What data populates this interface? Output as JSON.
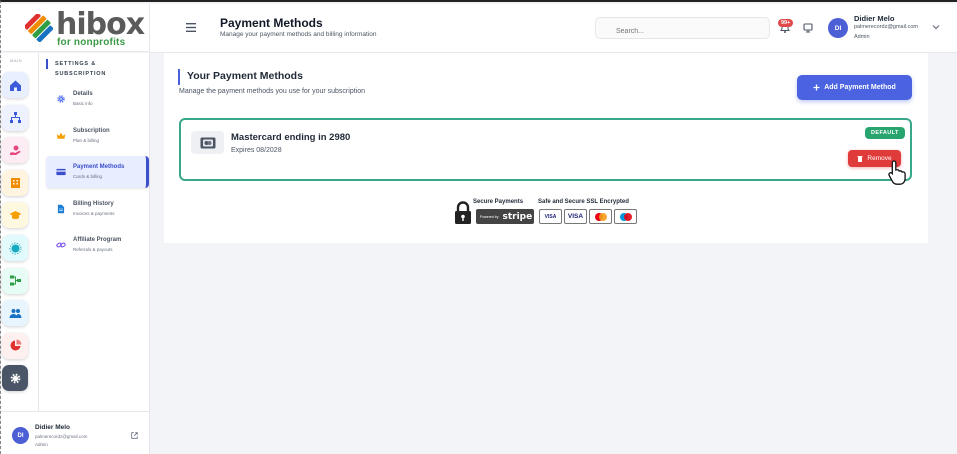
{
  "brand": {
    "name": "hibox",
    "subtitle": "for nonprofits"
  },
  "rail": {
    "label": "MAIN",
    "items": [
      {
        "name": "home",
        "icon": "home-icon",
        "color": "#3b5bdb",
        "bg": "#e8f0ff"
      },
      {
        "name": "org",
        "icon": "sitemap-icon",
        "color": "#3b5bdb",
        "bg": "#eef2ff"
      },
      {
        "name": "donations",
        "icon": "hand-holding-icon",
        "color": "#e64980",
        "bg": "#fdecf3"
      },
      {
        "name": "library",
        "icon": "building-icon",
        "color": "#f08c00",
        "bg": "#fff4e0"
      },
      {
        "name": "education",
        "icon": "graduation-cap-icon",
        "color": "#f59f00",
        "bg": "#fff8e1"
      },
      {
        "name": "bubbles",
        "icon": "bubble-icon",
        "color": "#15aabf",
        "bg": "#e3fafc"
      },
      {
        "name": "flows",
        "icon": "flow-icon",
        "color": "#2f9e44",
        "bg": "#e6fcf5"
      },
      {
        "name": "people",
        "icon": "users-icon",
        "color": "#1971c2",
        "bg": "#e7f5ff"
      },
      {
        "name": "reports",
        "icon": "pie-chart-icon",
        "color": "#e03131",
        "bg": "#fff0f0"
      },
      {
        "name": "settings",
        "icon": "gear-icon",
        "color": "#ffffff",
        "bg": "#4a5568"
      }
    ]
  },
  "settings_panel": {
    "title": "SETTINGS & SUBSCRIPTION",
    "items": [
      {
        "title": "Details",
        "sub": "Basic info",
        "icon": "gear-icon",
        "color": "#4c6ef5"
      },
      {
        "title": "Subscription",
        "sub": "Plan & billing",
        "icon": "crown-icon",
        "color": "#f59f00"
      },
      {
        "title": "Payment Methods",
        "sub": "Cards & billing",
        "icon": "credit-card-icon",
        "color": "#3b4ecb"
      },
      {
        "title": "Billing History",
        "sub": "Invoices & payments",
        "icon": "document-icon",
        "color": "#1c7ed6"
      },
      {
        "title": "Affiliate Program",
        "sub": "Referrals & payouts",
        "icon": "link-icon",
        "color": "#7048e8"
      }
    ]
  },
  "user": {
    "initials": "DI",
    "name": "Didier Melo",
    "email": "palmerecordz@gmail.com",
    "role": "Admin"
  },
  "header": {
    "title": "Payment Methods",
    "subtitle": "Manage your payment methods and billing information",
    "search_placeholder": "Search...",
    "notif_badge": "99+"
  },
  "section": {
    "title": "Your Payment Methods",
    "subtitle": "Manage the payment methods you use for your subscription",
    "add_button": "Add Payment Method"
  },
  "payment_method": {
    "title": "Mastercard ending in 2980",
    "expires": "Expires 08/2028",
    "badge": "DEFAULT",
    "remove": "Remove"
  },
  "secure": {
    "payments": "Secure Payments",
    "powered": "Powered by",
    "stripe": "stripe",
    "ssl": "Safe and Secure SSL Encrypted",
    "cards": [
      "VISA",
      "VISA",
      "mastercard",
      "maestro"
    ]
  },
  "colors": {
    "accent": "#4b63e0",
    "success": "#28a46e",
    "danger": "#e03b3b",
    "card_border": "#3aa78a"
  }
}
